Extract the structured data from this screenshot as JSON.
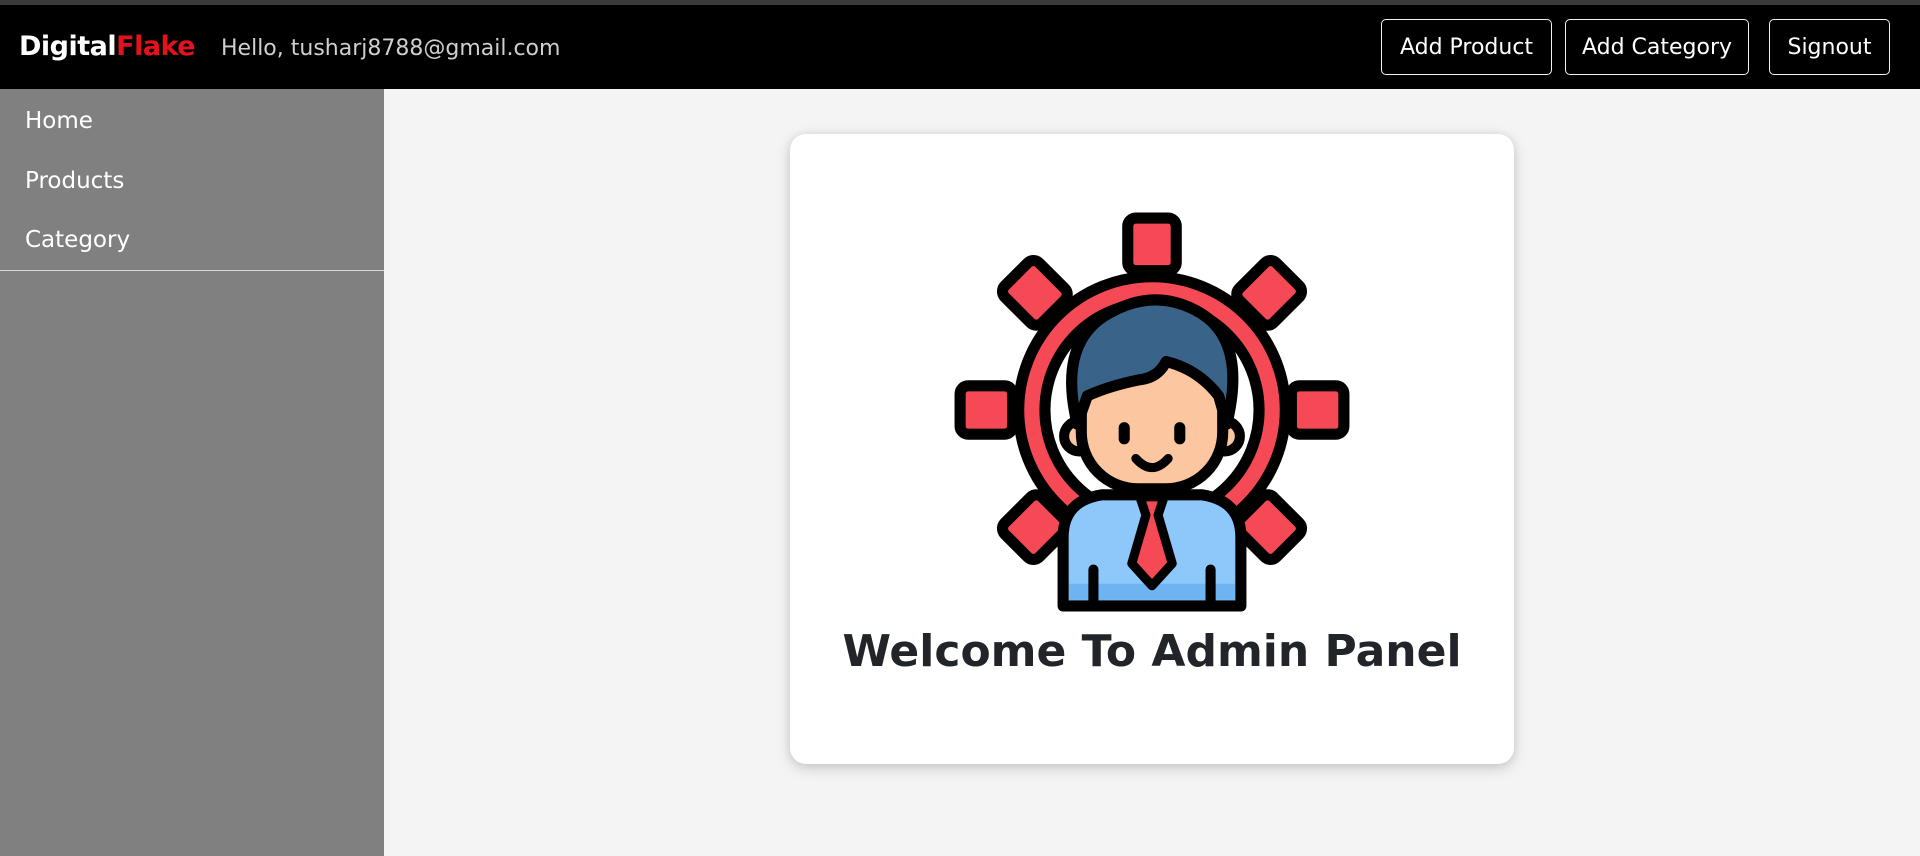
{
  "navbar": {
    "brand_part1": "Digital",
    "brand_part2": "Flake",
    "greeting": "Hello, tusharj8788@gmail.com",
    "buttons": {
      "add_product": "Add Product",
      "add_category": "Add Category",
      "signout": "Signout"
    }
  },
  "sidebar": {
    "items": [
      {
        "label": "Home"
      },
      {
        "label": "Products"
      },
      {
        "label": "Category"
      }
    ]
  },
  "main": {
    "illustration_icon": "admin-gear-person-icon",
    "welcome_text": "Welcome To Admin Panel"
  },
  "colors": {
    "navbar_bg": "#000000",
    "brand_accent": "#e4121b",
    "sidebar_bg": "#808080",
    "content_bg": "#f4f4f4",
    "gear_red": "#f54a55",
    "hair_blue": "#3a6389",
    "shirt_blue": "#8ec8fb"
  }
}
